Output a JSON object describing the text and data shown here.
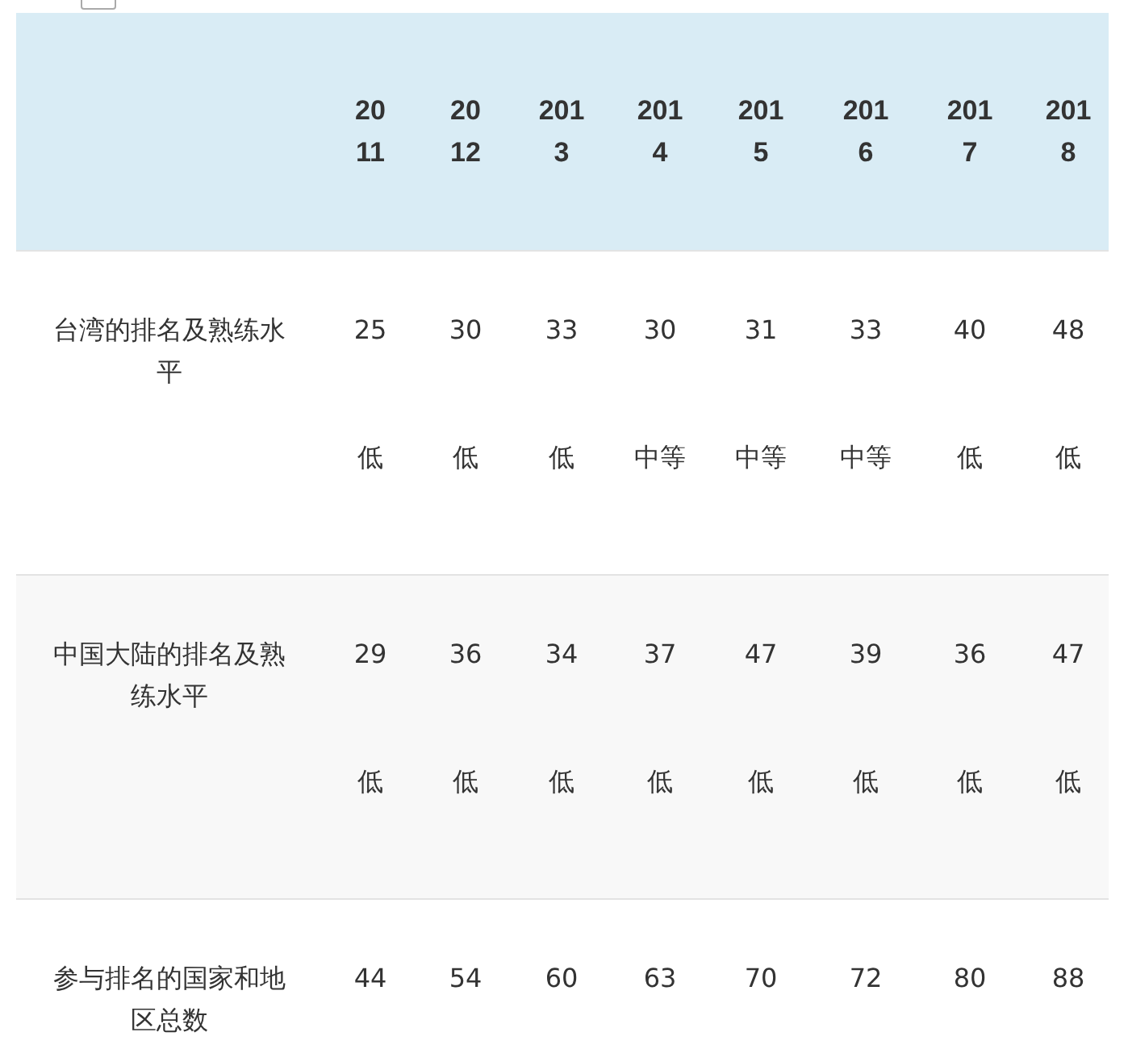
{
  "filter": {
    "checked": false
  },
  "table": {
    "columns": [
      "2011",
      "2012",
      "2013",
      "2014",
      "2015",
      "2016",
      "2017",
      "2018"
    ],
    "rows": [
      {
        "label": "台湾的排名及熟练水平",
        "values": [
          {
            "rank": "25",
            "level": "低"
          },
          {
            "rank": "30",
            "level": "低"
          },
          {
            "rank": "33",
            "level": "低"
          },
          {
            "rank": "30",
            "level": "中等"
          },
          {
            "rank": "31",
            "level": "中等"
          },
          {
            "rank": "33",
            "level": "中等"
          },
          {
            "rank": "40",
            "level": "低"
          },
          {
            "rank": "48",
            "level": "低"
          }
        ]
      },
      {
        "label": "中国大陆的排名及熟练水平",
        "values": [
          {
            "rank": "29",
            "level": "低"
          },
          {
            "rank": "36",
            "level": "低"
          },
          {
            "rank": "34",
            "level": "低"
          },
          {
            "rank": "37",
            "level": "低"
          },
          {
            "rank": "47",
            "level": "低"
          },
          {
            "rank": "39",
            "level": "低"
          },
          {
            "rank": "36",
            "level": "低"
          },
          {
            "rank": "47",
            "level": "低"
          }
        ]
      },
      {
        "label": "参与排名的国家和地区总数",
        "values": [
          {
            "rank": "44"
          },
          {
            "rank": "54"
          },
          {
            "rank": "60"
          },
          {
            "rank": "63"
          },
          {
            "rank": "70"
          },
          {
            "rank": "72"
          },
          {
            "rank": "80"
          },
          {
            "rank": "88"
          }
        ]
      }
    ]
  }
}
